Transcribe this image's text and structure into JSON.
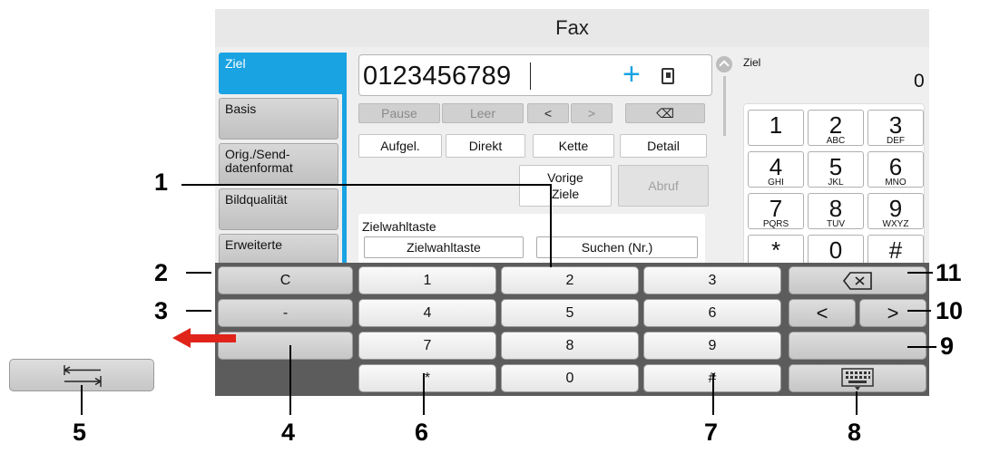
{
  "screen": {
    "title": "Fax",
    "tabs": [
      "Ziel",
      "Basis",
      "Orig./Send-\ndatenformat",
      "Bildqualität",
      "Erweiterte"
    ],
    "number_field": {
      "value": "0123456789",
      "add_symbol": "+"
    },
    "edit_buttons": {
      "pause": "Pause",
      "space": "Leer",
      "left": "<",
      "right": ">",
      "backspace": "⌫"
    },
    "options": {
      "chain": "Aufgel.",
      "direct": "Direkt",
      "kette": "Kette",
      "detail": "Detail"
    },
    "prev_dest": "Vorige\nZiele",
    "poll": "Abruf",
    "panel": {
      "label": "Zielwahltaste",
      "button1": "Zielwahltaste",
      "button2": "Suchen (Nr.)"
    },
    "dest_label": "Ziel",
    "dest_count": "0",
    "minipad": [
      {
        "d": "1",
        "l": ""
      },
      {
        "d": "2",
        "l": "ABC"
      },
      {
        "d": "3",
        "l": "DEF"
      },
      {
        "d": "4",
        "l": "GHI"
      },
      {
        "d": "5",
        "l": "JKL"
      },
      {
        "d": "6",
        "l": "MNO"
      },
      {
        "d": "7",
        "l": "PQRS"
      },
      {
        "d": "8",
        "l": "TUV"
      },
      {
        "d": "9",
        "l": "WXYZ"
      },
      {
        "d": "*",
        "l": ""
      },
      {
        "d": "0",
        "l": ""
      },
      {
        "d": "#",
        "l": ""
      }
    ]
  },
  "keypad": {
    "clear": "C",
    "hyphen": "-",
    "digits": [
      "1",
      "2",
      "3",
      "4",
      "5",
      "6",
      "7",
      "8",
      "9",
      "*",
      "0",
      "#"
    ],
    "backspace": "⌫",
    "left": "<",
    "right": ">"
  },
  "callouts": [
    "1",
    "2",
    "3",
    "4",
    "5",
    "6",
    "7",
    "8",
    "9",
    "10",
    "11"
  ],
  "colors": {
    "accent": "#1aa3e3",
    "arrow": "#e0241a"
  }
}
